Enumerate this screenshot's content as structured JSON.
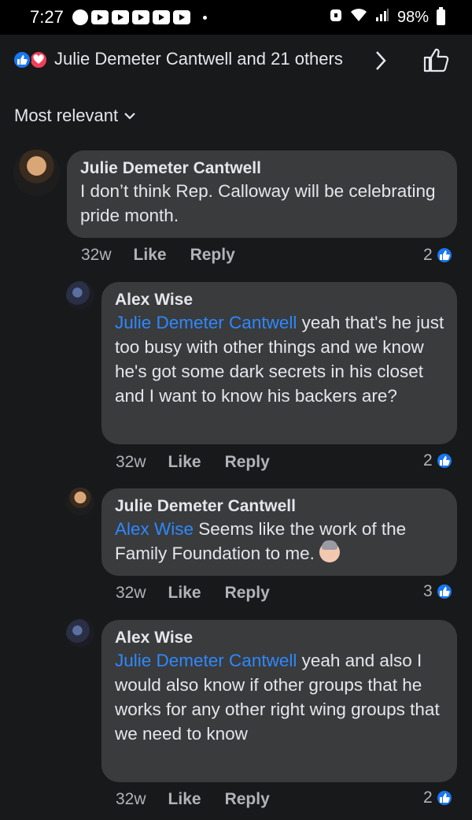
{
  "status_bar": {
    "time": "7:27",
    "battery": "98%",
    "icons": [
      "signal-notif-icon",
      "youtube-notif-icon",
      "youtube-notif-icon",
      "youtube-notif-icon",
      "youtube-notif-icon",
      "youtube-notif-icon",
      "youtube-notif-icon",
      "wifi-icon",
      "cell-signal-icon",
      "battery-icon"
    ]
  },
  "header": {
    "reactions": [
      "like",
      "love"
    ],
    "names": "Julie Demeter Cantwell and 21 others",
    "like_icon": "thumbs-up-outline-icon",
    "colors": {
      "like": "#1877f2",
      "love": "#f33e58"
    }
  },
  "sort": {
    "label": "Most relevant"
  },
  "comments": [
    {
      "author": "Julie Demeter Cantwell",
      "mention": "",
      "text": "I don’t think Rep. Calloway will be celebrating pride month.",
      "time": "32w",
      "like_label": "Like",
      "reply_label": "Reply",
      "like_count": "2"
    },
    {
      "author": "Alex Wise",
      "mention": "Julie Demeter Cantwell",
      "text": " yeah that's he just too busy with other things and we know he's got some dark secrets in his closet and I want to know his backers are?",
      "time": "32w",
      "like_label": "Like",
      "reply_label": "Reply",
      "like_count": "2"
    },
    {
      "author": "Julie Demeter Cantwell",
      "mention": "Alex Wise",
      "text": " Seems like the work of the Family Foundation to me.",
      "emoji": "woman-shrugging-emoji",
      "time": "32w",
      "like_label": "Like",
      "reply_label": "Reply",
      "like_count": "3"
    },
    {
      "author": "Alex Wise",
      "mention": "Julie Demeter Cantwell",
      "text": " yeah and also I would also know if other groups that he works for any other right wing groups that we need to know",
      "time": "32w",
      "like_label": "Like",
      "reply_label": "Reply",
      "like_count": "2"
    }
  ]
}
